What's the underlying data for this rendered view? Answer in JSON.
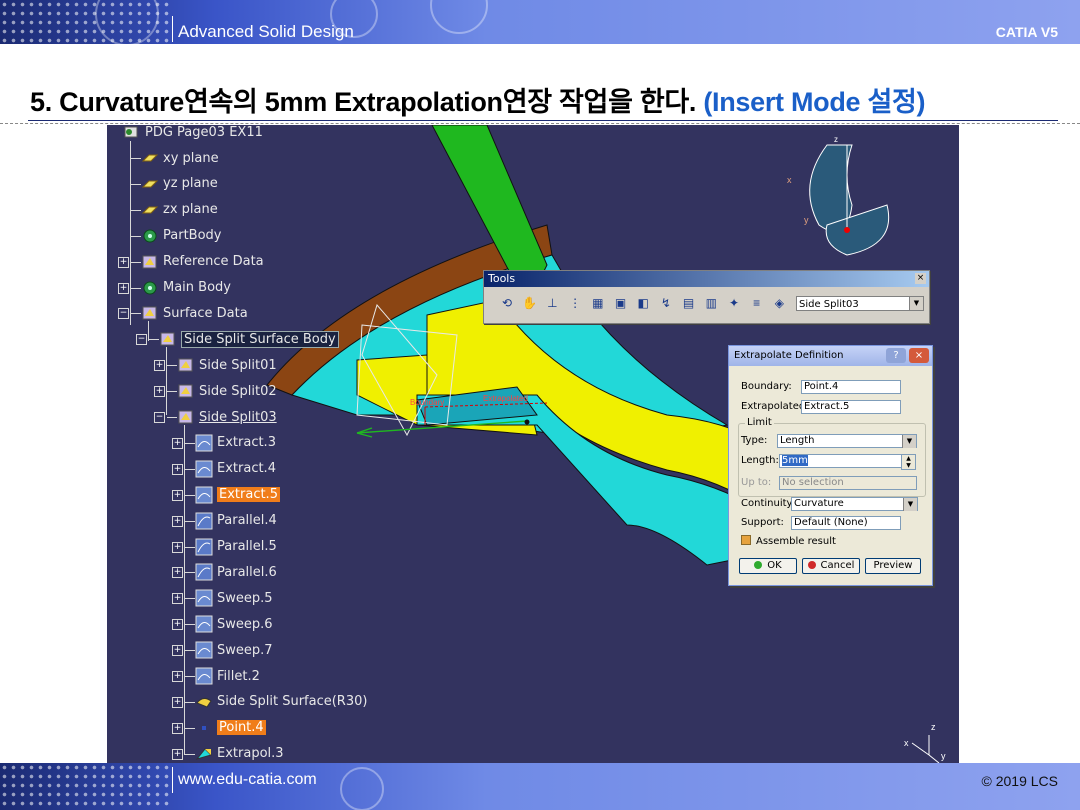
{
  "header": {
    "title": "Advanced Solid Design",
    "brand": "CATIA V5"
  },
  "footer": {
    "url": "www.edu-catia.com",
    "copyright": "© 2019 LCS"
  },
  "page_title": {
    "main": "5. Curvature연속의 5mm Extrapolation연장 작업을 한다. ",
    "highlight": "(Insert Mode 설정)"
  },
  "colors": {
    "accent": "#1a5fc8",
    "selected": "#f07d1a",
    "viewport_bg": "#33335f",
    "surface_cyan": "#22d8d8",
    "surface_yellow": "#f0f000",
    "surface_brown": "#8b4513"
  },
  "tree": {
    "root": "PDG Page03 EX11",
    "items": [
      {
        "label": "xy plane",
        "icon": "plane-icon"
      },
      {
        "label": "yz plane",
        "icon": "plane-icon"
      },
      {
        "label": "zx plane",
        "icon": "plane-icon"
      },
      {
        "label": "PartBody",
        "icon": "gear-icon"
      },
      {
        "label": "Reference Data",
        "icon": "geoset-icon"
      },
      {
        "label": "Main Body",
        "icon": "gear-icon"
      },
      {
        "label": "Surface Data",
        "icon": "geoset-icon"
      },
      {
        "label": "Side Split Surface Body",
        "icon": "geoset-icon"
      },
      {
        "label": "Side Split01",
        "icon": "geoset-icon"
      },
      {
        "label": "Side Split02",
        "icon": "geoset-icon"
      },
      {
        "label": "Side Split03",
        "icon": "geoset-icon"
      },
      {
        "label": "Extract.3",
        "icon": "surface-icon"
      },
      {
        "label": "Extract.4",
        "icon": "surface-icon"
      },
      {
        "label": "Extract.5",
        "icon": "surface-icon"
      },
      {
        "label": "Parallel.4",
        "icon": "curve-icon"
      },
      {
        "label": "Parallel.5",
        "icon": "curve-icon"
      },
      {
        "label": "Parallel.6",
        "icon": "curve-icon"
      },
      {
        "label": "Sweep.5",
        "icon": "surface-icon"
      },
      {
        "label": "Sweep.6",
        "icon": "surface-icon"
      },
      {
        "label": "Sweep.7",
        "icon": "surface-icon"
      },
      {
        "label": "Fillet.2",
        "icon": "surface-icon"
      },
      {
        "label": "Side Split Surface(R30)",
        "icon": "split-icon"
      },
      {
        "label": "Point.4",
        "icon": "point-icon"
      },
      {
        "label": "Extrapol.3",
        "icon": "extrapolate-icon"
      }
    ]
  },
  "annotations": {
    "boundary": "Boundary",
    "extrapolated": "Extrapolated"
  },
  "compass": {
    "z": "z",
    "x": "x",
    "y": "y"
  },
  "axes_small": {
    "z": "z",
    "x": "x",
    "y": "y"
  },
  "tools": {
    "title": "Tools",
    "close": "×",
    "icons": [
      "update-icon",
      "hand-icon",
      "axis-icon",
      "tree-icon",
      "grid-icon",
      "snap-icon",
      "plane-system-icon",
      "measure-icon",
      "catalog-icon",
      "fold-icon",
      "create-set-icon",
      "layer-icon",
      "geoset-select-icon"
    ],
    "current_set": "Side Split03"
  },
  "dialog": {
    "title": "Extrapolate Definition",
    "help": "?",
    "close": "×",
    "boundary_label": "Boundary:",
    "boundary_value": "Point.4",
    "extrapolated_label": "Extrapolated:",
    "extrapolated_value": "Extract.5",
    "limit_label": "Limit",
    "type_label": "Type:",
    "type_value": "Length",
    "length_label": "Length:",
    "length_value": "5mm",
    "upto_label": "Up to:",
    "upto_value": "No selection",
    "continuity_label": "Continuity:",
    "continuity_value": "Curvature",
    "support_label": "Support:",
    "support_value": "Default (None)",
    "assemble_label": "Assemble result",
    "ok": "OK",
    "cancel": "Cancel",
    "preview": "Preview"
  }
}
